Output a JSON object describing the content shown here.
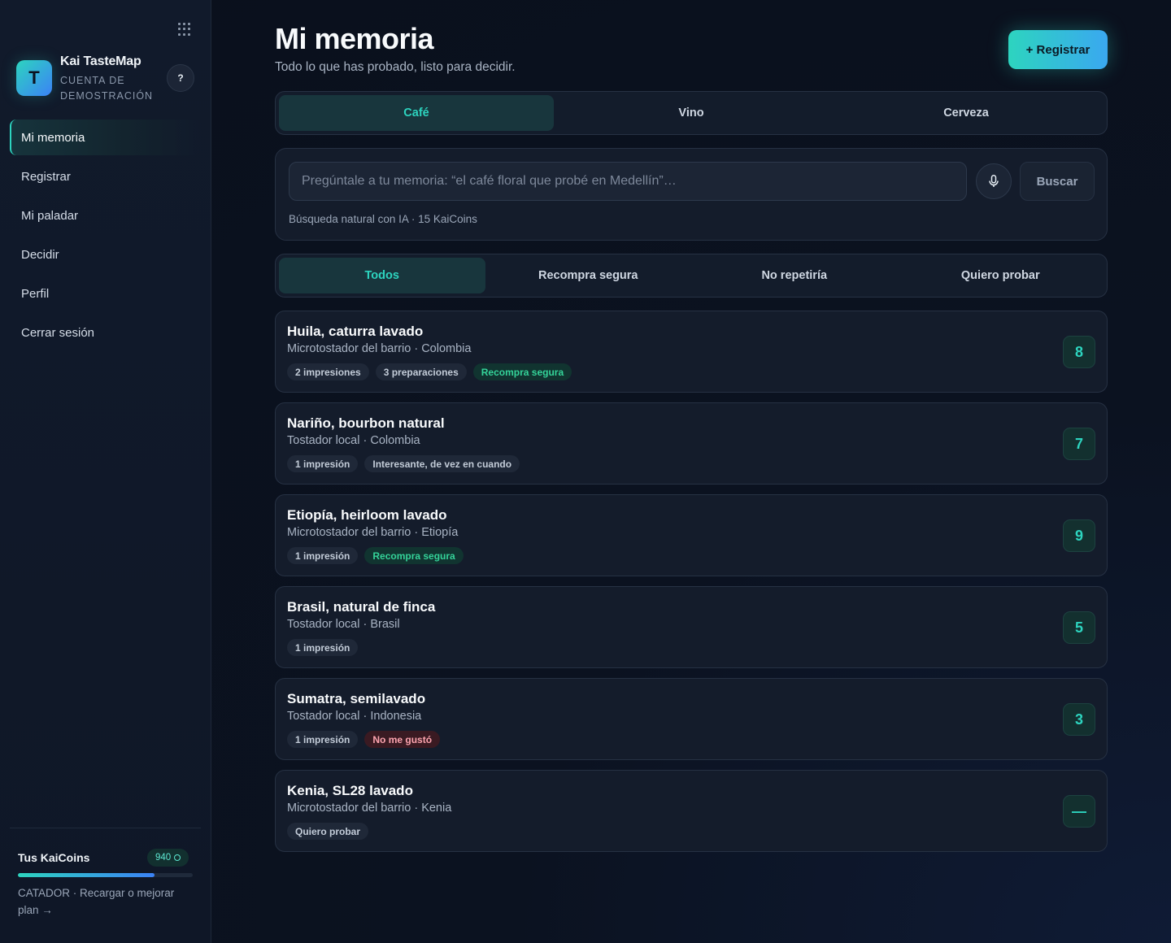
{
  "sidebar": {
    "brand": {
      "logo_letter": "T",
      "name": "Kai TasteMap",
      "subtitle": "CUENTA DE DEMOSTRACIÓN"
    },
    "help_label": "?",
    "nav": [
      {
        "label": "Mi memoria",
        "active": true
      },
      {
        "label": "Registrar",
        "active": false
      },
      {
        "label": "Mi paladar",
        "active": false
      },
      {
        "label": "Decidir",
        "active": false
      },
      {
        "label": "Perfil",
        "active": false
      },
      {
        "label": "Cerrar sesión",
        "active": false
      }
    ],
    "coins": {
      "label": "Tus KaiCoins",
      "amount": "940",
      "progress": 0.78,
      "plan_text": "CATADOR · Recargar o mejorar plan →"
    }
  },
  "header": {
    "title": "Mi memoria",
    "subtitle": "Todo lo que has probado, listo para decidir.",
    "register_label": "+ Registrar"
  },
  "category_tabs": [
    {
      "label": "Café",
      "active": true
    },
    {
      "label": "Vino",
      "active": false
    },
    {
      "label": "Cerveza",
      "active": false
    }
  ],
  "search": {
    "placeholder": "Pregúntale a tu memoria: “el café floral que probé en Medellín”…",
    "button_label": "Buscar",
    "hint": "Búsqueda natural con IA · 15 KaiCoins"
  },
  "filter_tabs": [
    {
      "label": "Todos",
      "active": true
    },
    {
      "label": "Recompra segura",
      "active": false
    },
    {
      "label": "No repetiría",
      "active": false
    },
    {
      "label": "Quiero probar",
      "active": false
    }
  ],
  "items": [
    {
      "title": "Huila, caturra lavado",
      "subtitle": "Microtostador del barrio · Colombia",
      "chips": [
        {
          "label": "2 impresiones",
          "tone": "neutral"
        },
        {
          "label": "3 preparaciones",
          "tone": "neutral"
        },
        {
          "label": "Recompra segura",
          "tone": "good"
        }
      ],
      "score": "8"
    },
    {
      "title": "Nariño, bourbon natural",
      "subtitle": "Tostador local · Colombia",
      "chips": [
        {
          "label": "1 impresión",
          "tone": "neutral"
        },
        {
          "label": "Interesante, de vez en cuando",
          "tone": "neutral"
        }
      ],
      "score": "7"
    },
    {
      "title": "Etiopía, heirloom lavado",
      "subtitle": "Microtostador del barrio · Etiopía",
      "chips": [
        {
          "label": "1 impresión",
          "tone": "neutral"
        },
        {
          "label": "Recompra segura",
          "tone": "good"
        }
      ],
      "score": "9"
    },
    {
      "title": "Brasil, natural de finca",
      "subtitle": "Tostador local · Brasil",
      "chips": [
        {
          "label": "1 impresión",
          "tone": "neutral"
        }
      ],
      "score": "5"
    },
    {
      "title": "Sumatra, semilavado",
      "subtitle": "Tostador local · Indonesia",
      "chips": [
        {
          "label": "1 impresión",
          "tone": "neutral"
        },
        {
          "label": "No me gustó",
          "tone": "bad"
        }
      ],
      "score": "3"
    },
    {
      "title": "Kenia, SL28 lavado",
      "subtitle": "Microtostador del barrio · Kenia",
      "chips": [
        {
          "label": "Quiero probar",
          "tone": "neutral"
        }
      ],
      "score": "—"
    }
  ]
}
